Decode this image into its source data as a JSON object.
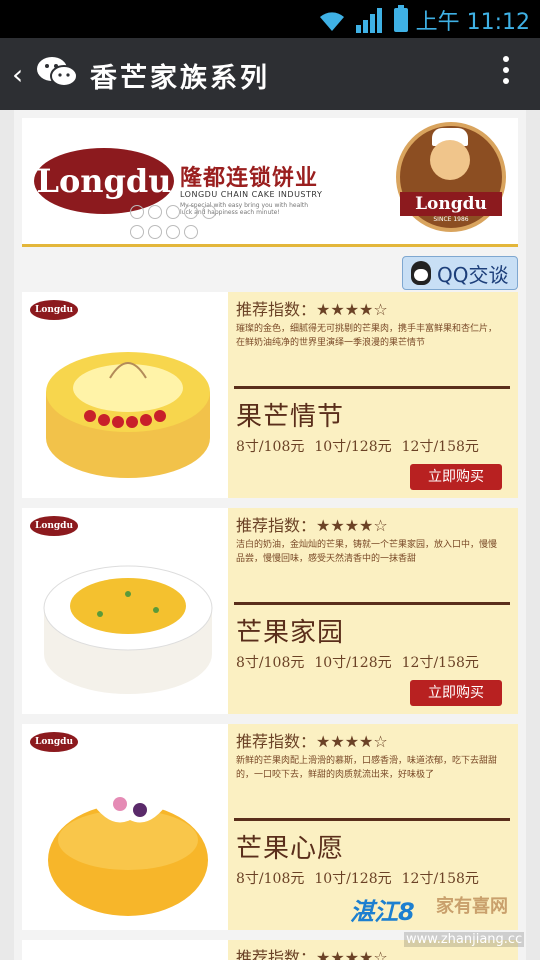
{
  "status_bar": {
    "time_label": "上午 11:12"
  },
  "title_bar": {
    "title": "香芒家族系列"
  },
  "banner": {
    "logo_text": "Longdu",
    "company_cn": "隆都连锁饼业",
    "company_en": "LONGDU CHAIN CAKE INDUSTRY",
    "slogan": "My special with easy bring you with health luck and happiness each minute!",
    "seal_text": "Longdu",
    "seal_year": "SINCE 1986"
  },
  "qq_button": {
    "label": "QQ交谈"
  },
  "rating_label": "推荐指数：",
  "rating_stars": "★★★★☆",
  "buy_label": "立即购买",
  "products": [
    {
      "name": "果芒情节",
      "desc": "璀璨的金色，细腻得无可挑剔的芒果肉，携手丰富鲜果和杏仁片，在鲜奶油纯净的世界里演绎一季浪漫的果芒情节",
      "prices": [
        "8寸/108元",
        "10寸/128元",
        "12寸/158元"
      ]
    },
    {
      "name": "芒果家园",
      "desc": "洁白的奶油，金灿灿的芒果，铸就一个芒果家园，放入口中，慢慢品尝，慢慢回味，感受天然清香中的一抹香甜",
      "prices": [
        "8寸/108元",
        "10寸/128元",
        "12寸/158元"
      ]
    },
    {
      "name": "芒果心愿",
      "desc": "新鲜的芒果肉配上滑滑的慕斯，口感香滑，味道浓郁，吃下去甜甜的，一口咬下去，鲜甜的肉质就流出来，好味极了",
      "prices": [
        "8寸/108元",
        "10寸/128元",
        "12寸/158元"
      ]
    }
  ],
  "watermark": {
    "logo": "湛江8",
    "cn": "家有喜网",
    "url": "www.zhanjiang.cc"
  },
  "colors": {
    "title_bg": "#2d2f33",
    "card_bg": "#fbf0c2",
    "buy_button": "#b82121",
    "brand": "#8c1a1e"
  }
}
